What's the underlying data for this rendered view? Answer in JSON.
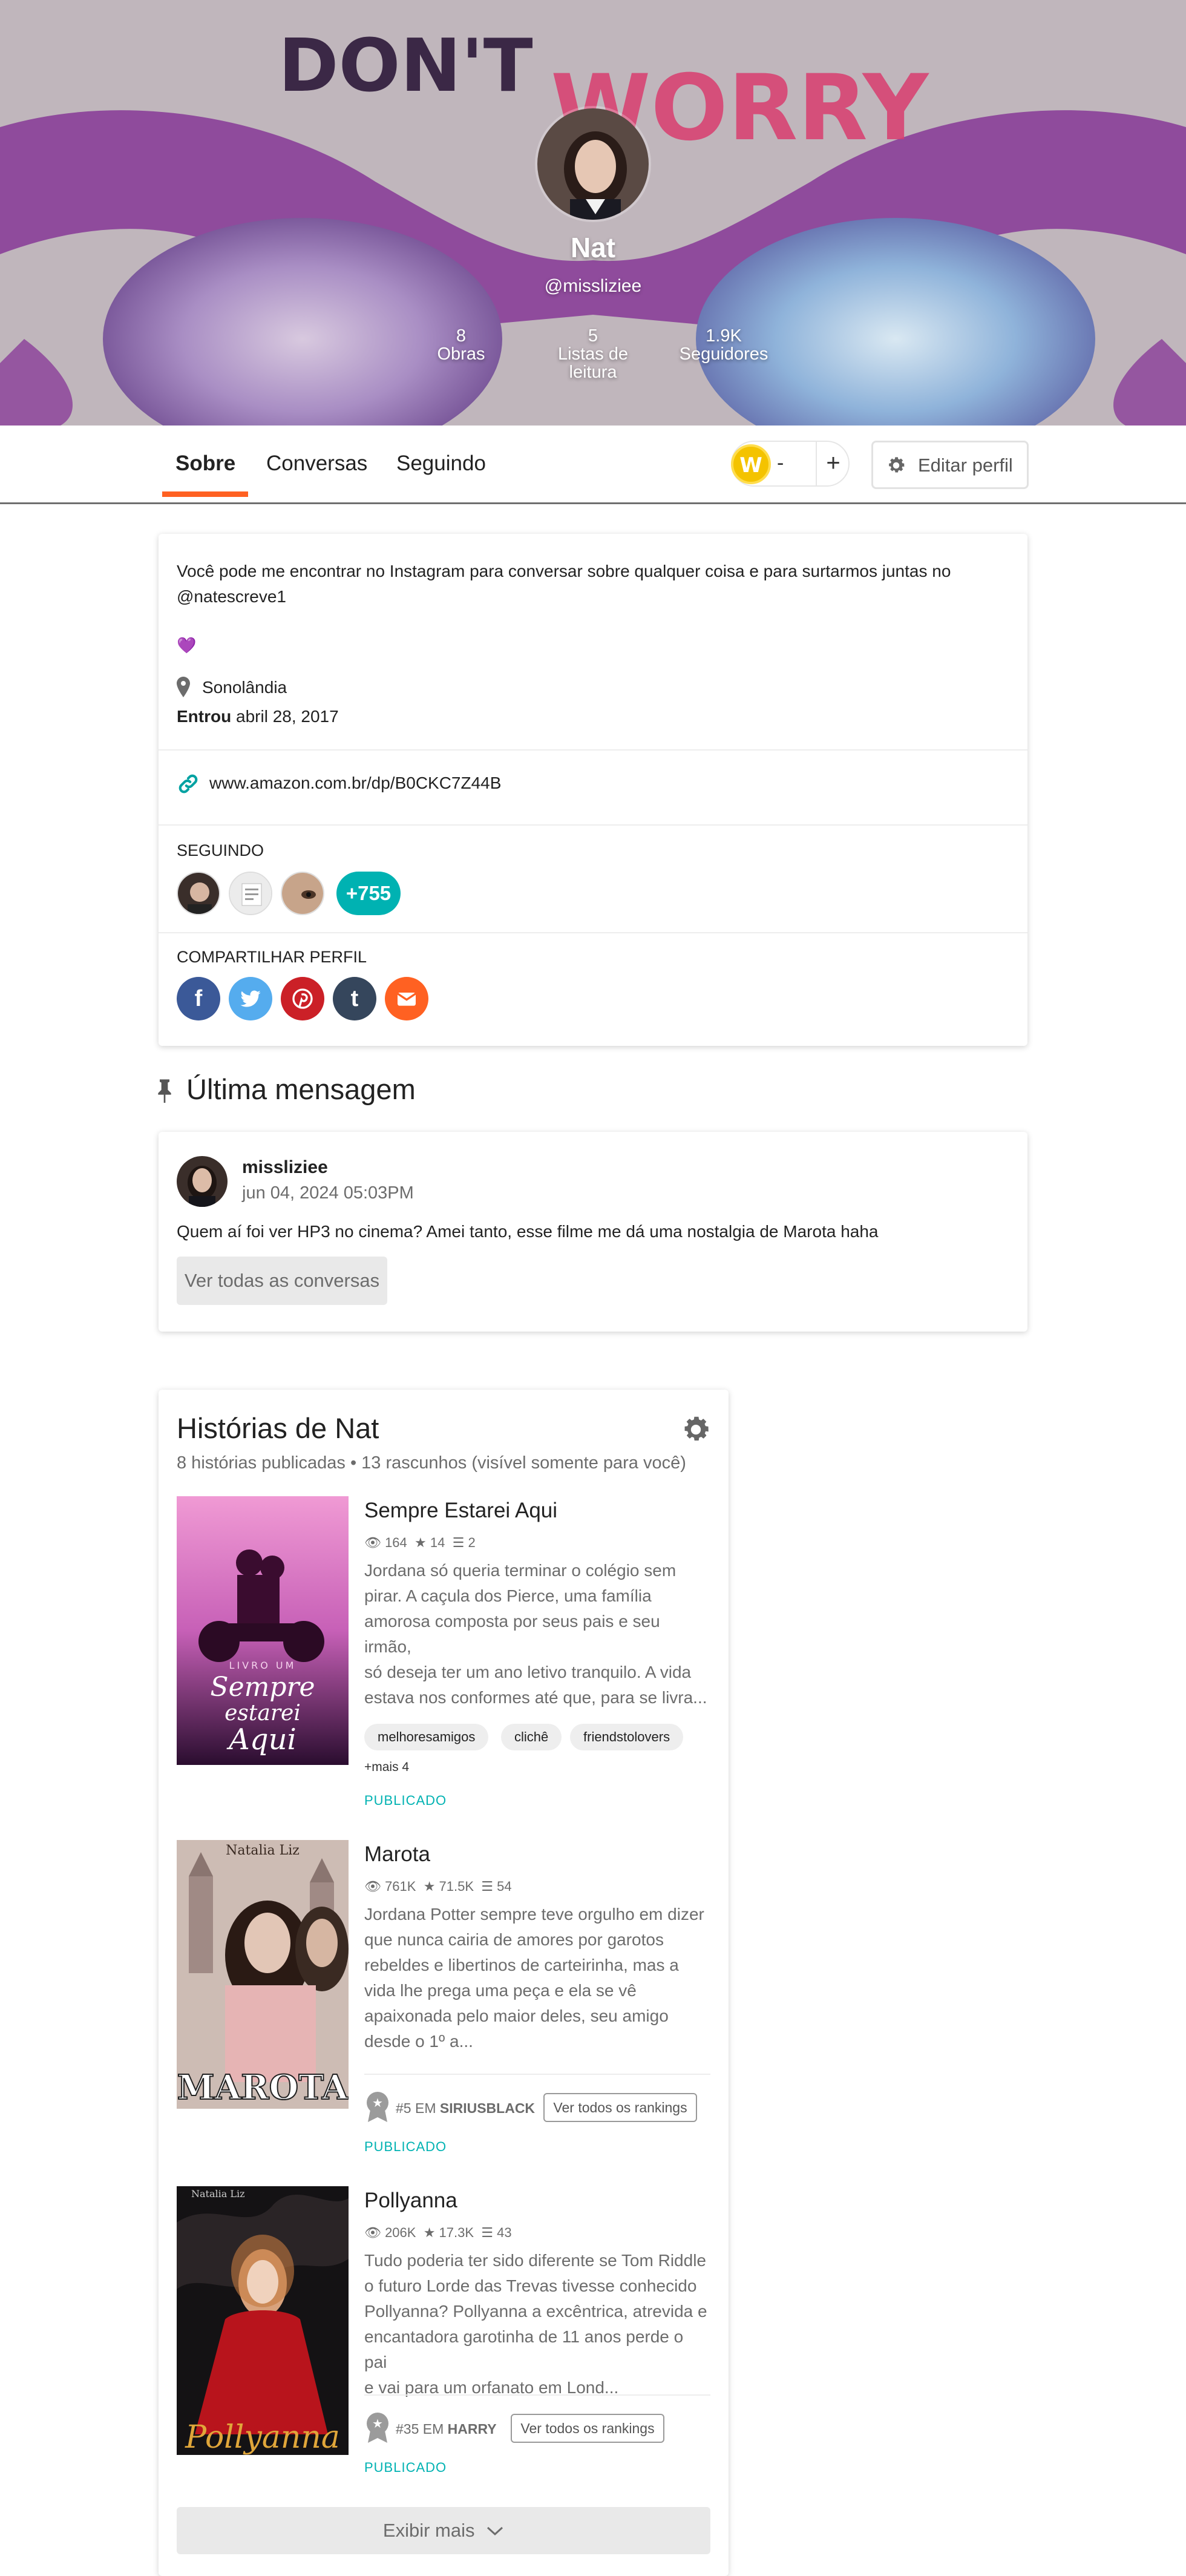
{
  "profile": {
    "name": "Nat",
    "handle": "@missliziee",
    "stats": [
      {
        "value": "8",
        "label": "Obras"
      },
      {
        "value": "5",
        "label": "Listas de leitura"
      },
      {
        "value": "1.9K",
        "label": "Seguidores"
      }
    ]
  },
  "header_art": {
    "word1": "DON'T",
    "word2": "WORRY"
  },
  "nav": {
    "tabs": [
      "Sobre",
      "Conversas",
      "Seguindo"
    ],
    "coins": "-",
    "plus": "+",
    "edit_profile": "Editar perfil"
  },
  "about": {
    "bio_line1": "Você pode me encontrar no Instagram para conversar sobre qualquer coisa e para surtarmos juntas no",
    "bio_line2": "@natescreve1",
    "heart": "💜",
    "location": "Sonolândia",
    "joined_label": "Entrou",
    "joined_date": "abril 28, 2017",
    "link": "www.amazon.com.br/dp/B0CKC7Z44B",
    "following_title": "SEGUINDO",
    "following_more": "+755",
    "share_title": "COMPARTILHAR PERFIL",
    "share_icons": [
      "facebook-icon",
      "twitter-icon",
      "pinterest-icon",
      "tumblr-icon",
      "email-icon"
    ]
  },
  "last_message": {
    "title": "Última mensagem",
    "author": "missliziee",
    "date": "jun 04, 2024 05:03PM",
    "text": "Quem aí foi ver HP3 no cinema? Amei tanto, esse filme me dá uma nostalgia de Marota haha",
    "button": "Ver todas as conversas"
  },
  "stories": {
    "title": "Histórias de Nat",
    "subtitle": "8 histórias publicadas • 13 rascunhos (visível somente para você)",
    "items": [
      {
        "title": "Sempre Estarei Aqui",
        "reads": "164",
        "votes": "14",
        "parts": "2",
        "desc": [
          "Jordana só queria terminar o colégio sem",
          "pirar. A caçula dos Pierce, uma família",
          "amorosa composta por seus pais e seu irmão,",
          "só deseja ter um ano letivo tranquilo. A vida",
          "estava nos conformes até que, para se livra..."
        ],
        "tags": [
          "melhoresamigos",
          "clichê",
          "friendstolovers"
        ],
        "more_tags": "+mais 4",
        "status": "PUBLICADO",
        "cover_top": "LIVRO UM",
        "cover_title": [
          "Sempre",
          "estarei",
          "Aqui"
        ]
      },
      {
        "title": "Marota",
        "reads": "761K",
        "votes": "71.5K",
        "parts": "54",
        "desc": [
          "Jordana Potter sempre teve orgulho em dizer",
          "que nunca cairia de amores por garotos",
          "rebeldes e libertinos de carteirinha, mas a",
          "vida lhe prega uma peça e ela se vê",
          "apaixonada pelo maior deles, seu amigo",
          "desde o 1º a..."
        ],
        "rank_prefix": "#5 EM",
        "rank_tag": "SIRIUSBLACK",
        "rank_button": "Ver todos os rankings",
        "status": "PUBLICADO",
        "cover_author": "Natalia Liz",
        "cover_title": "MAROTA"
      },
      {
        "title": "Pollyanna",
        "reads": "206K",
        "votes": "17.3K",
        "parts": "43",
        "desc": [
          "Tudo poderia ter sido diferente se Tom Riddle",
          "o futuro Lorde das Trevas tivesse conhecido",
          "Pollyanna? Pollyanna a excêntrica, atrevida e",
          "encantadora garotinha de 11 anos perde o pai",
          "e vai para um orfanato em Lond..."
        ],
        "rank_prefix": "#35 EM",
        "rank_tag": "HARRY",
        "rank_button": "Ver todos os rankings",
        "status": "PUBLICADO",
        "cover_author": "Natalia Liz",
        "cover_title": "Pollyanna"
      }
    ],
    "show_more": "Exibir mais"
  }
}
